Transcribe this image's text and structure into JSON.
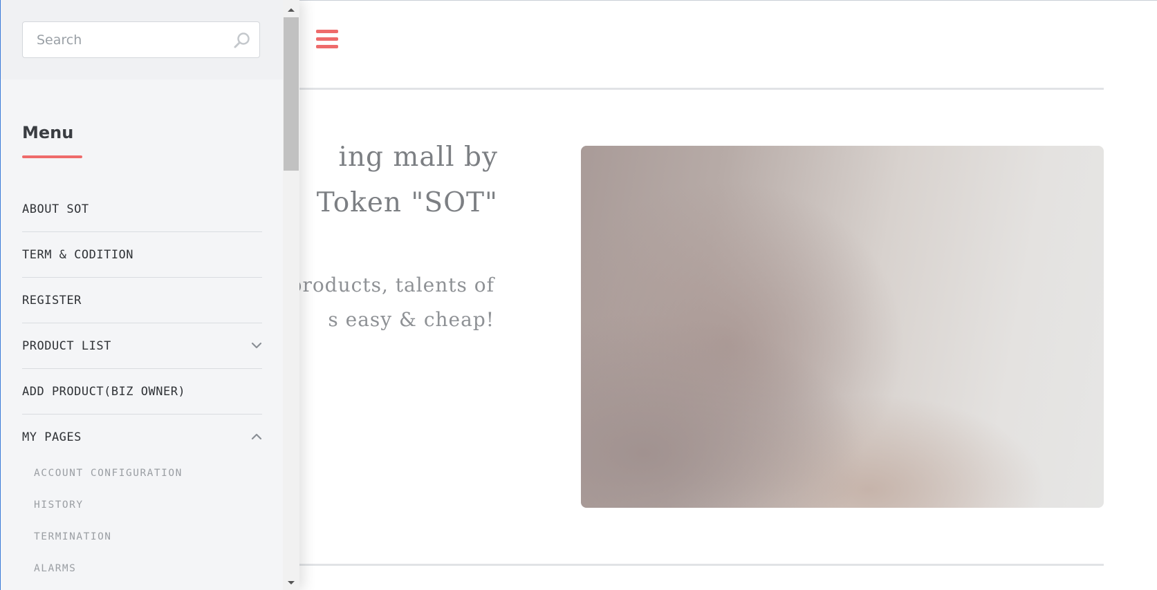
{
  "search": {
    "placeholder": "Search"
  },
  "menu": {
    "heading": "Menu",
    "items": [
      {
        "label": "ABOUT SOT"
      },
      {
        "label": "TERM & CODITION"
      },
      {
        "label": "REGISTER"
      },
      {
        "label": "PRODUCT LIST",
        "chevron": "chevron-down-icon"
      },
      {
        "label": "ADD PRODUCT(BIZ OWNER)"
      },
      {
        "label": "MY PAGES",
        "chevron": "chevron-up-icon",
        "expanded": true
      }
    ],
    "submenu": [
      {
        "label": "ACCOUNT CONFIGURATION"
      },
      {
        "label": "HISTORY"
      },
      {
        "label": "TERMINATION"
      },
      {
        "label": "ALARMS"
      }
    ]
  },
  "hero": {
    "title_line1": "ing mall by",
    "title_line2": "Token \"SOT\"",
    "sub_line1": "products, talents of",
    "sub_line2": "s easy & cheap!"
  },
  "icons": {
    "menu_toggle": "hamburger-icon",
    "search": "search-icon"
  },
  "colors": {
    "accent": "#ee6b6b",
    "sidebar_bg": "#f4f5f7",
    "text_muted": "#7c7f83"
  }
}
